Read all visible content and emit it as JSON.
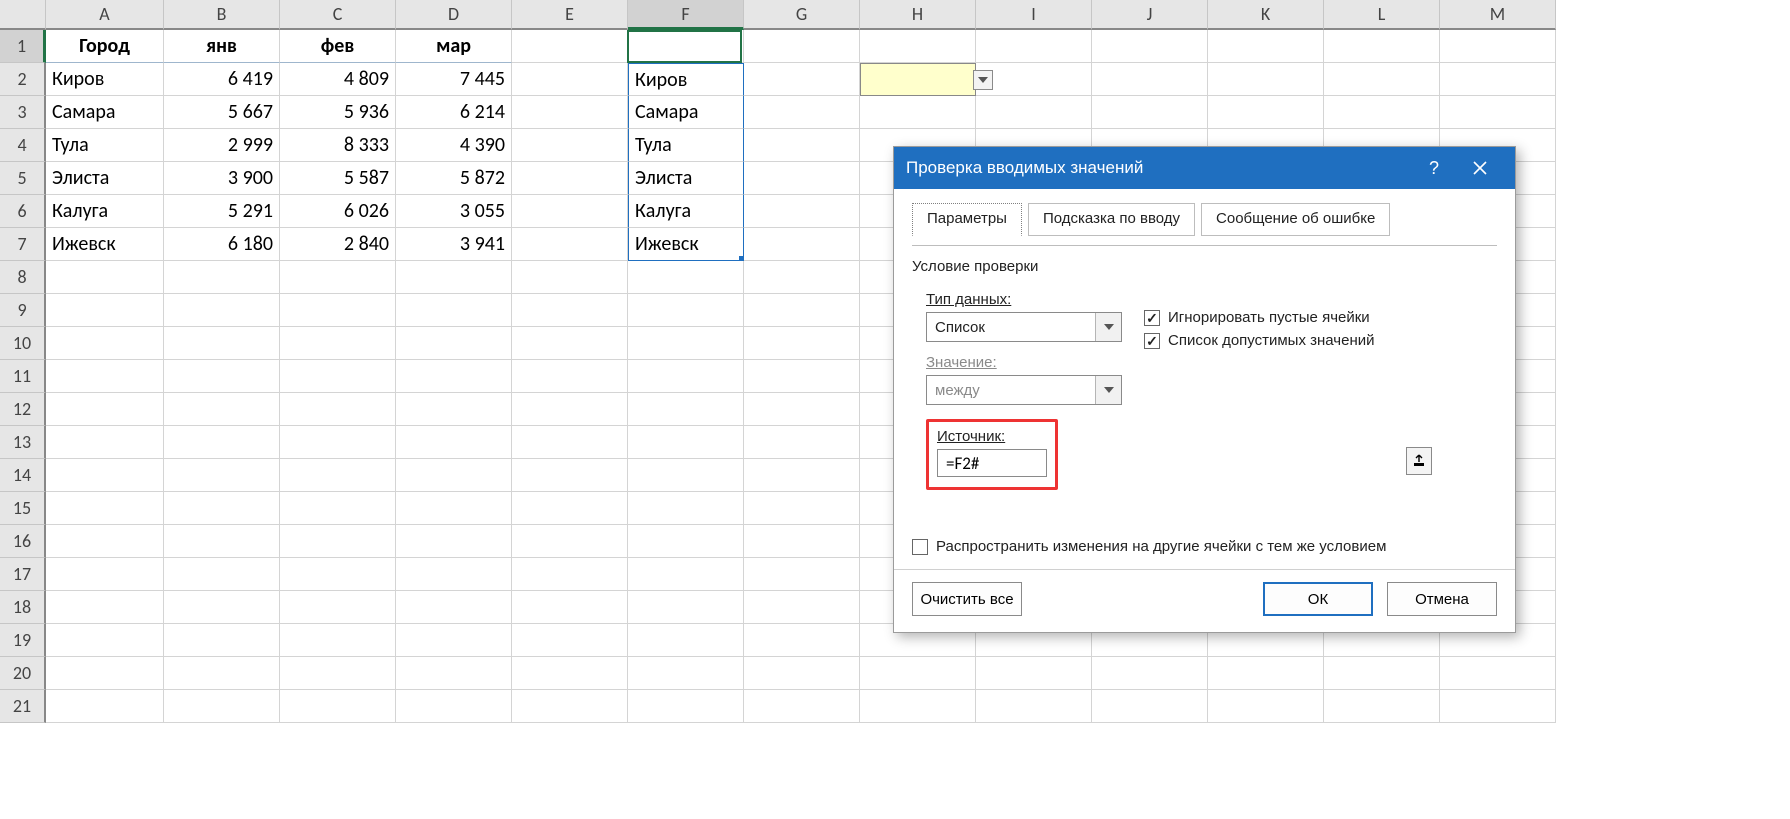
{
  "columns": [
    "A",
    "B",
    "C",
    "D",
    "E",
    "F",
    "G",
    "H",
    "I",
    "J",
    "K",
    "L",
    "M"
  ],
  "rowCount": 21,
  "table": {
    "headers": {
      "city": "Город",
      "jan": "янв",
      "feb": "фев",
      "mar": "мар"
    },
    "rows": [
      {
        "city": "Киров",
        "jan": "6 419",
        "feb": "4 809",
        "mar": "7 445"
      },
      {
        "city": "Самара",
        "jan": "5 667",
        "feb": "5 936",
        "mar": "6 214"
      },
      {
        "city": "Тула",
        "jan": "2 999",
        "feb": "8 333",
        "mar": "4 390"
      },
      {
        "city": "Элиста",
        "jan": "3 900",
        "feb": "5 587",
        "mar": "5 872"
      },
      {
        "city": "Калуга",
        "jan": "5 291",
        "feb": "6 026",
        "mar": "3 055"
      },
      {
        "city": "Ижевск",
        "jan": "6 180",
        "feb": "2 840",
        "mar": "3 941"
      }
    ]
  },
  "spillList": [
    "Киров",
    "Самара",
    "Тула",
    "Элиста",
    "Калуга",
    "Ижевск"
  ],
  "validationCell": {
    "col": "H",
    "row": 2,
    "value": ""
  },
  "dialog": {
    "title": "Проверка вводимых значений",
    "tabs": {
      "params": "Параметры",
      "hint": "Подсказка по вводу",
      "error": "Сообщение об ошибке"
    },
    "groupLabel": "Условие проверки",
    "dataTypeLabel": "Тип данных:",
    "dataTypeValue": "Список",
    "valueLabel": "Значение:",
    "valueValue": "между",
    "ignoreBlankLabel": "Игнорировать пустые ячейки",
    "ignoreBlankChecked": true,
    "inCellDropdownLabel": "Список допустимых значений",
    "inCellDropdownChecked": true,
    "sourceLabel": "Источник:",
    "sourceValue": "=F2#",
    "propagateLabel": "Распространить изменения на другие ячейки с тем же условием",
    "propagateChecked": false,
    "clearAll": "Очистить все",
    "ok": "ОК",
    "cancel": "Отмена"
  }
}
